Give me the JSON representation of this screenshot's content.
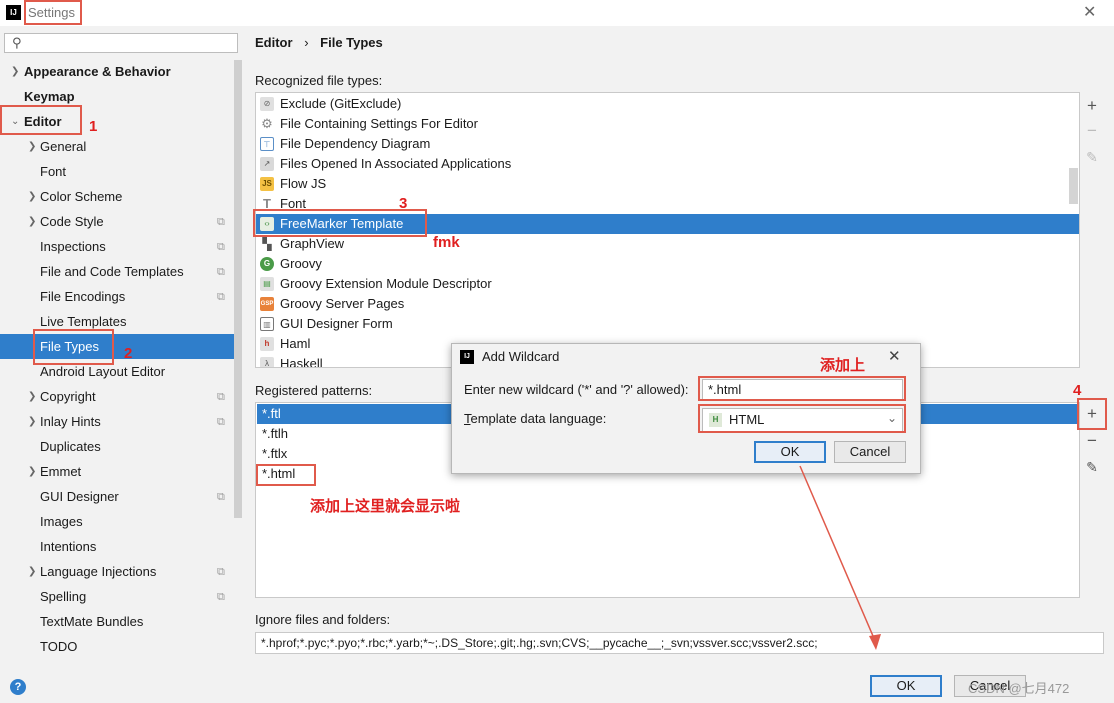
{
  "window": {
    "title": "Settings",
    "app_icon": "IJ"
  },
  "sidebar": {
    "search_placeholder": "",
    "items": [
      {
        "label": "Appearance & Behavior"
      },
      {
        "label": "Keymap"
      },
      {
        "label": "Editor"
      },
      {
        "label": "General"
      },
      {
        "label": "Font"
      },
      {
        "label": "Color Scheme"
      },
      {
        "label": "Code Style"
      },
      {
        "label": "Inspections"
      },
      {
        "label": "File and Code Templates"
      },
      {
        "label": "File Encodings"
      },
      {
        "label": "Live Templates"
      },
      {
        "label": "File Types"
      },
      {
        "label": "Android Layout Editor"
      },
      {
        "label": "Copyright"
      },
      {
        "label": "Inlay Hints"
      },
      {
        "label": "Duplicates"
      },
      {
        "label": "Emmet"
      },
      {
        "label": "GUI Designer"
      },
      {
        "label": "Images"
      },
      {
        "label": "Intentions"
      },
      {
        "label": "Language Injections"
      },
      {
        "label": "Spelling"
      },
      {
        "label": "TextMate Bundles"
      },
      {
        "label": "TODO"
      }
    ]
  },
  "breadcrumb": {
    "parent": "Editor",
    "separator": "›",
    "current": "File Types"
  },
  "recognized": {
    "label": "Recognized file types:",
    "items": [
      {
        "name": "Exclude (GitExclude)",
        "icon": "exclude-icon"
      },
      {
        "name": "File Containing Settings For Editor",
        "icon": "gear-icon"
      },
      {
        "name": "File Dependency Diagram",
        "icon": "diagram-icon"
      },
      {
        "name": "Files Opened In Associated Applications",
        "icon": "external-app-icon"
      },
      {
        "name": "Flow JS",
        "icon": "js-icon",
        "badge": "JS"
      },
      {
        "name": "Font",
        "icon": "font-icon",
        "badge": "T"
      },
      {
        "name": "FreeMarker Template",
        "icon": "freemarker-icon"
      },
      {
        "name": "GraphView",
        "icon": "graphview-icon"
      },
      {
        "name": "Groovy",
        "icon": "groovy-icon",
        "badge": "G"
      },
      {
        "name": "Groovy Extension Module Descriptor",
        "icon": "groovy-ext-icon"
      },
      {
        "name": "Groovy Server Pages",
        "icon": "gsp-icon",
        "badge": "GSP"
      },
      {
        "name": "GUI Designer Form",
        "icon": "form-icon"
      },
      {
        "name": "Haml",
        "icon": "haml-icon",
        "badge": "h"
      },
      {
        "name": "Haskell",
        "icon": "haskell-icon"
      }
    ]
  },
  "patterns": {
    "label": "Registered patterns:",
    "items": [
      "*.ftl",
      "*.ftlh",
      "*.ftlx",
      "*.html"
    ]
  },
  "ignore": {
    "label": "Ignore files and folders:",
    "value": "*.hprof;*.pyc;*.pyo;*.rbc;*.yarb;*~;.DS_Store;.git;.hg;.svn;CVS;__pycache__;_svn;vssver.scc;vssver2.scc;"
  },
  "dialog": {
    "title": "Add Wildcard",
    "wildcard_label": "Enter new wildcard ('*' and '?' allowed):",
    "wildcard_value": "*.html",
    "lang_label_u": "T",
    "lang_label_rest": "emplate data language:",
    "lang_value": "HTML",
    "ok": "OK",
    "cancel": "Cancel"
  },
  "footer": {
    "ok": "OK",
    "cancel": "Cancel",
    "help": "?"
  },
  "annotations": {
    "n1": "1",
    "n2": "2",
    "n3": "3",
    "n4": "4",
    "fmk": "fmk",
    "add_here": "添加上",
    "shows_here": "添加上这里就会显示啦"
  },
  "watermark": "CSDN @七月472",
  "colors": {
    "selection": "#2f7ecb",
    "annotation": "#e02020"
  }
}
